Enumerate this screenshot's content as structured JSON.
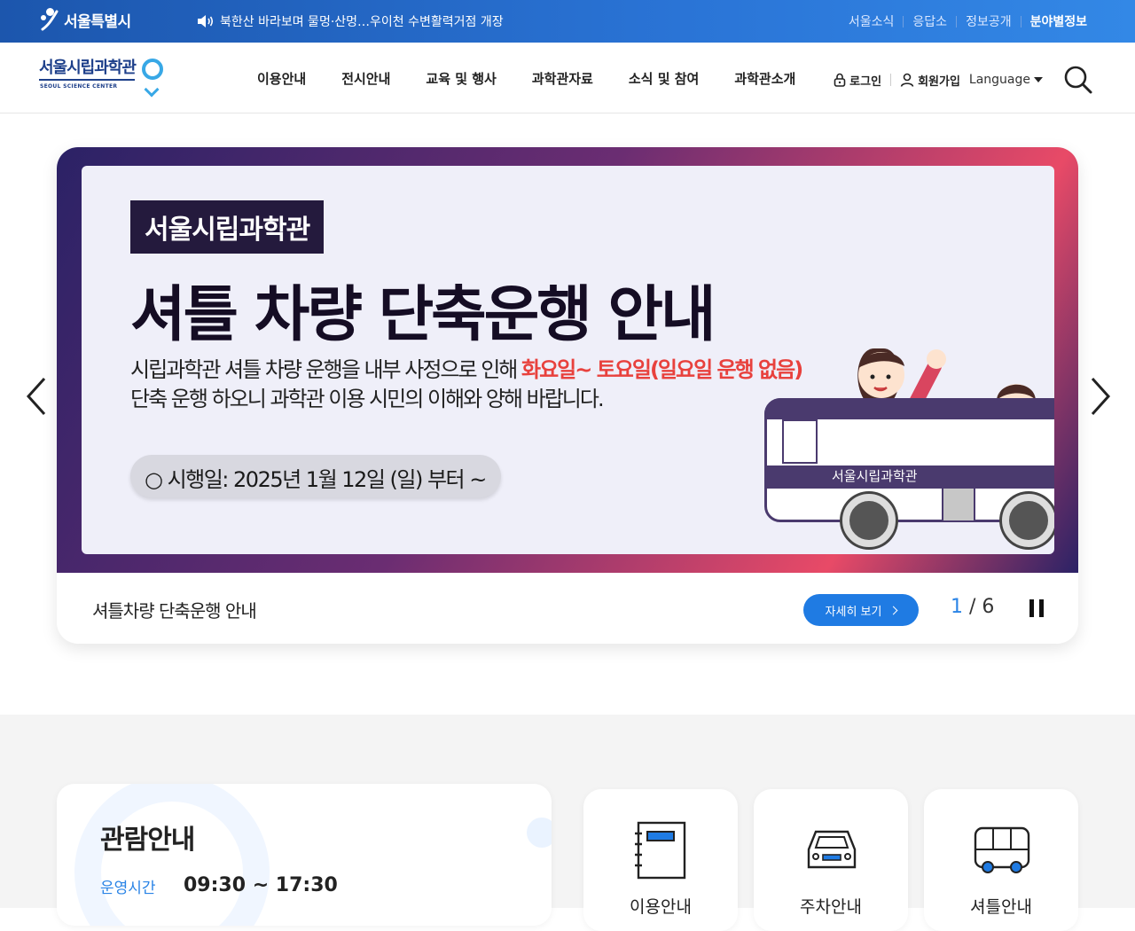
{
  "topbar": {
    "logo_text": "서울특별시",
    "notice": "북한산 바라보며 물멍·산멍…우이천 수변활력거점 개장",
    "links": [
      {
        "label": "서울소식",
        "strong": false
      },
      {
        "label": "응답소",
        "strong": false
      },
      {
        "label": "정보공개",
        "strong": false
      },
      {
        "label": "분야별정보",
        "strong": true
      }
    ]
  },
  "header": {
    "logo_kr": "서울시립과학관",
    "logo_en": "SEOUL SCIENCE CENTER",
    "nav": [
      "이용안내",
      "전시안내",
      "교육 및 행사",
      "과학관자료",
      "소식 및 참여",
      "과학관소개"
    ],
    "login": "로그인",
    "signup": "회원가입",
    "language": "Language"
  },
  "slider": {
    "tag": "서울시립과학관",
    "title": "셔틀 차량 단축운행 안내",
    "desc_line1_pre": "시립과학관 셔틀 차량 운행을 내부 사정으로 인해 ",
    "desc_line1_hl": "화요일~ 토요일(일요일 운행 없음)",
    "desc_line2": "단축 운행 하오니 과학관 이용 시민의 이해와 양해 바랍니다.",
    "date": "○ 시행일: 2025년 1월 12일 (일) 부터 ~",
    "bus_label": "서울시립과학관",
    "caption": "셔틀차량 단축운행 안내",
    "more": "자세히 보기",
    "current": "1",
    "total": "/ 6"
  },
  "info": {
    "title": "관람안내",
    "hours_label": "운영시간",
    "hours_value": "09:30 ~ 17:30"
  },
  "quick_links": [
    "이용안내",
    "주차안내",
    "셔틀안내"
  ],
  "colors": {
    "topbar": "#2a74d6",
    "brand_navy": "#1d3f8a",
    "accent_blue": "#1f7be3",
    "highlight_red": "#e8413d",
    "slide_dark": "#241a3d"
  }
}
